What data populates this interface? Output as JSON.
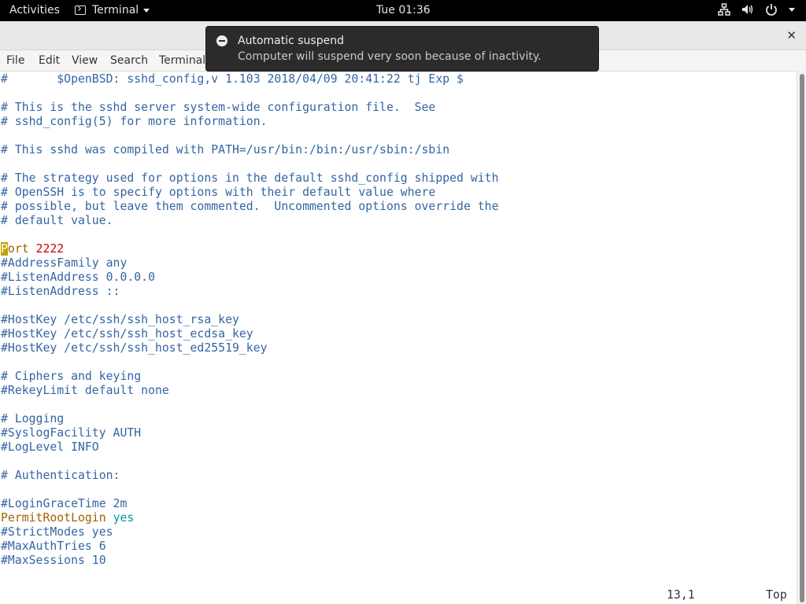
{
  "topbar": {
    "activities": "Activities",
    "app_name": "Terminal",
    "clock": "Tue 01:36",
    "icons": [
      "network-icon",
      "volume-icon",
      "power-icon",
      "system-menu-caret-icon"
    ]
  },
  "window": {
    "close_icon": "close-icon"
  },
  "menubar": {
    "file": "File",
    "edit": "Edit",
    "view": "View",
    "search": "Search",
    "terminal": "Terminal"
  },
  "notification": {
    "title": "Automatic suspend",
    "body": "Computer will suspend very soon because of inactivity."
  },
  "editor": {
    "lines": [
      "#\t$OpenBSD: sshd_config,v 1.103 2018/04/09 20:41:22 tj Exp $",
      "",
      "# This is the sshd server system-wide configuration file.  See",
      "# sshd_config(5) for more information.",
      "",
      "# This sshd was compiled with PATH=/usr/bin:/bin:/usr/sbin:/sbin",
      "",
      "# The strategy used for options in the default sshd_config shipped with",
      "# OpenSSH is to specify options with their default value where",
      "# possible, but leave them commented.  Uncommented options override the",
      "# default value.",
      "",
      "Port 2222",
      "#AddressFamily any",
      "#ListenAddress 0.0.0.0",
      "#ListenAddress ::",
      "",
      "#HostKey /etc/ssh/ssh_host_rsa_key",
      "#HostKey /etc/ssh/ssh_host_ecdsa_key",
      "#HostKey /etc/ssh/ssh_host_ed25519_key",
      "",
      "# Ciphers and keying",
      "#RekeyLimit default none",
      "",
      "# Logging",
      "#SyslogFacility AUTH",
      "#LogLevel INFO",
      "",
      "# Authentication:",
      "",
      "#LoginGraceTime 2m",
      "PermitRootLogin yes",
      "#StrictModes yes",
      "#MaxAuthTries 6",
      "#MaxSessions 10"
    ],
    "cursor_position": "13,1",
    "scroll_position": "Top"
  },
  "colors": {
    "comment": "#3465a4",
    "keyword": "#a06000",
    "number": "#cc0000",
    "value": "#06989a",
    "cursor": "#c4a000"
  }
}
